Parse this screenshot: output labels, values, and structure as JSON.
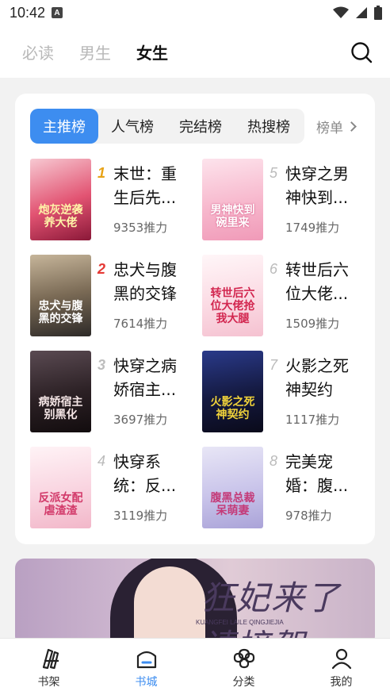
{
  "status": {
    "time": "10:42",
    "notif_icon": "A"
  },
  "tabs": [
    {
      "label": "必读"
    },
    {
      "label": "男生"
    },
    {
      "label": "女生"
    }
  ],
  "ranking_tabs": [
    {
      "label": "主推榜"
    },
    {
      "label": "人气榜"
    },
    {
      "label": "完结榜"
    },
    {
      "label": "热搜榜"
    }
  ],
  "ranking_more": "榜单",
  "books": [
    {
      "rank": "1",
      "title": "末世：重生后先...",
      "heat": "9353推力",
      "cover_text": "炮灰逆袭养大佬"
    },
    {
      "rank": "2",
      "title": "忠犬与腹黑的交锋",
      "heat": "7614推力",
      "cover_text": "忠犬与腹黑的交锋"
    },
    {
      "rank": "3",
      "title": "快穿之病娇宿主...",
      "heat": "3697推力",
      "cover_text": "病娇宿主别黑化"
    },
    {
      "rank": "4",
      "title": "快穿系统：反...",
      "heat": "3119推力",
      "cover_text": "反派女配虐渣渣"
    },
    {
      "rank": "5",
      "title": "快穿之男神快到...",
      "heat": "1749推力",
      "cover_text": "男神快到碗里来"
    },
    {
      "rank": "6",
      "title": "转世后六位大佬...",
      "heat": "1509推力",
      "cover_text": "转世后六位大佬抢我大腿"
    },
    {
      "rank": "7",
      "title": "火影之死神契约",
      "heat": "1117推力",
      "cover_text": "火影之死神契约"
    },
    {
      "rank": "8",
      "title": "完美宠婚：腹...",
      "heat": "978推力",
      "cover_text": "腹黑总裁呆萌妻"
    }
  ],
  "banner": {
    "title": "狂妃来了请接驾",
    "subtitle": "KUANGFEI LAILE QINGJIEJIA"
  },
  "bottom_nav": [
    {
      "label": "书架"
    },
    {
      "label": "书城"
    },
    {
      "label": "分类"
    },
    {
      "label": "我的"
    }
  ],
  "colors": {
    "accent": "#3d8df0",
    "rank1": "#e8a317",
    "rank2": "#e53935",
    "rank3": "#bdbdbd",
    "rank_other": "#bbbbbb"
  }
}
